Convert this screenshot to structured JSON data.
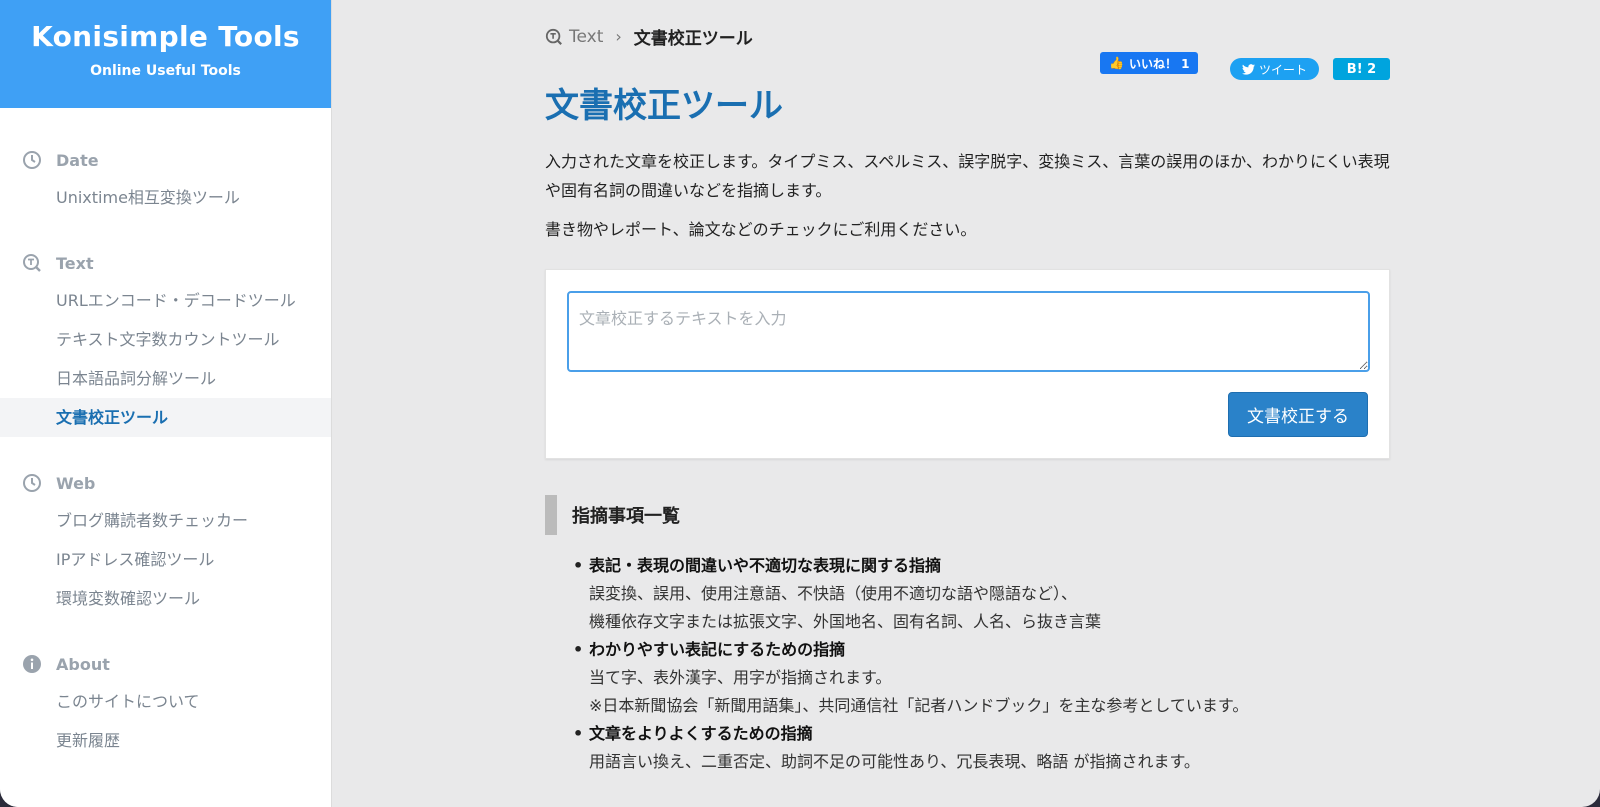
{
  "brand": {
    "title": "Konisimple Tools",
    "subtitle": "Online Useful Tools"
  },
  "sidebar": {
    "groups": [
      {
        "label": "Date",
        "icon": "clock-icon",
        "items": [
          "Unixtime相互変換ツール"
        ]
      },
      {
        "label": "Text",
        "icon": "text-search-icon",
        "items": [
          "URLエンコード・デコードツール",
          "テキスト文字数カウントツール",
          "日本語品詞分解ツール",
          "文書校正ツール"
        ]
      },
      {
        "label": "Web",
        "icon": "clock-icon",
        "items": [
          "ブログ購読者数チェッカー",
          "IPアドレス確認ツール",
          "環境変数確認ツール"
        ]
      },
      {
        "label": "About",
        "icon": "info-icon",
        "items": [
          "このサイトについて",
          "更新履歴"
        ]
      }
    ],
    "active_item": "文書校正ツール"
  },
  "breadcrumb": {
    "parent": "Text",
    "current": "文書校正ツール"
  },
  "social": {
    "like": "いいね！ 1",
    "tweet": "ツイート",
    "hatena": "B! 2"
  },
  "page": {
    "title": "文書校正ツール",
    "desc1": "入力された文章を校正します。タイプミス、スペルミス、誤字脱字、変換ミス、言葉の誤用のほか、わかりにくい表現や固有名詞の間違いなどを指摘します。",
    "desc2": "書き物やレポート、論文などのチェックにご利用ください。"
  },
  "form": {
    "placeholder": "文章校正するテキストを入力",
    "value": "",
    "submit_label": "文書校正する"
  },
  "section": {
    "title": "指摘事項一覧",
    "items": [
      {
        "title": "表記・表現の間違いや不適切な表現に関する指摘",
        "lines": [
          "誤変換、誤用、使用注意語、不快語（使用不適切な語や隠語など）、",
          "機種依存文字または拡張文字、外国地名、固有名詞、人名、ら抜き言葉"
        ]
      },
      {
        "title": "わかりやすい表記にするための指摘",
        "lines": [
          "当て字、表外漢字、用字が指摘されます。",
          "※日本新聞協会「新聞用語集」、共同通信社「記者ハンドブック」を主な参考としています。"
        ]
      },
      {
        "title": "文章をよりよくするための指摘",
        "lines": [
          "用語言い換え、二重否定、助詞不足の可能性あり、冗長表現、略語 が指摘されます。"
        ]
      }
    ]
  },
  "colors": {
    "brand": "#3fa0f5",
    "accent": "#1a6fb1",
    "button": "#2a82c9"
  }
}
